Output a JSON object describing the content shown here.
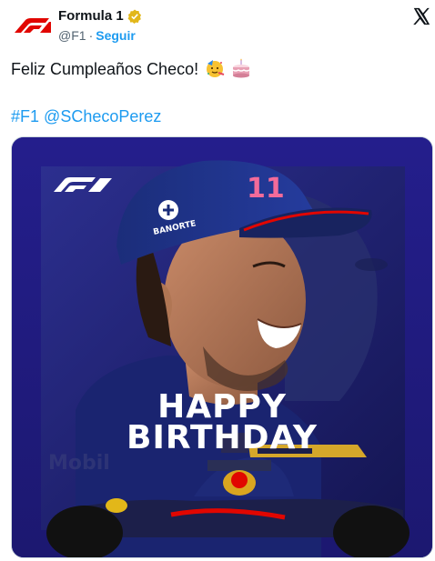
{
  "account": {
    "display_name": "Formula 1",
    "handle": "@F1",
    "separator": "·",
    "follow_label": "Seguir"
  },
  "tweet": {
    "text": "Feliz Cumpleaños Checo!",
    "emojis": [
      "party-face-emoji",
      "birthday-cake-emoji"
    ],
    "hashtag": "#F1",
    "mention": "@SChecoPerez"
  },
  "media": {
    "headline_line1": "HAPPY",
    "headline_line2": "BIRTHDAY",
    "cap_number": "11",
    "sponsor_text": "BANORTE",
    "background_color": "#23208a"
  },
  "colors": {
    "f1_red": "#e10600",
    "link_blue": "#1d9bf0",
    "verified_gold": "#e2b719",
    "text_primary": "#0f1419",
    "text_secondary": "#536471"
  }
}
